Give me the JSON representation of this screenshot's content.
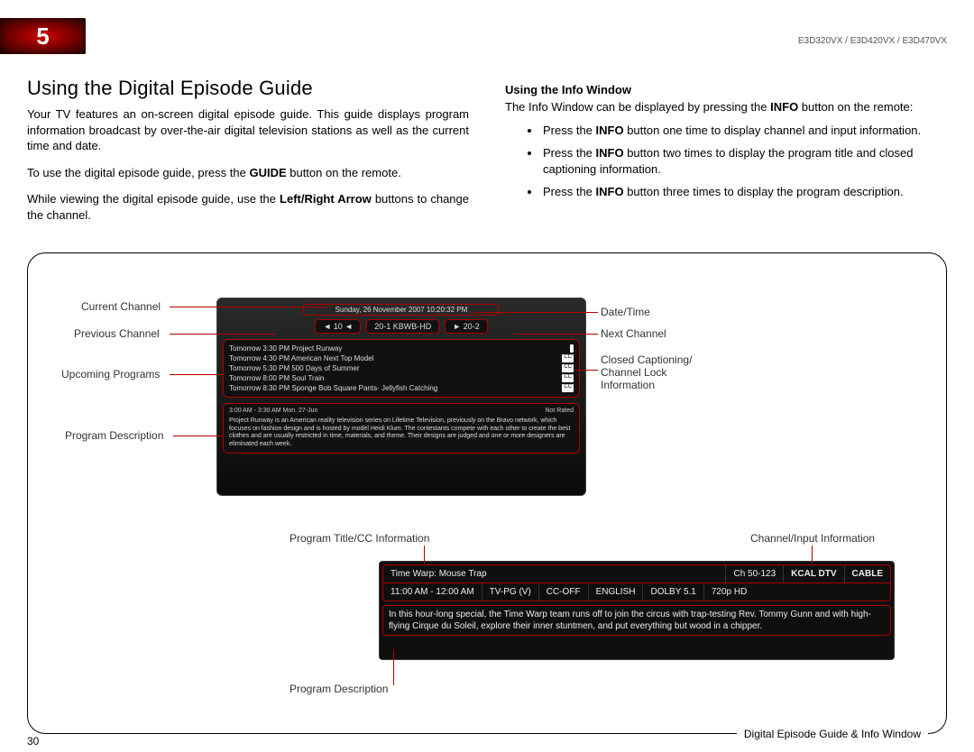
{
  "header": {
    "chapter_number": "5",
    "model_line": "E3D320VX / E3D420VX / E3D470VX"
  },
  "page_number": "30",
  "frame_caption": "Digital Episode Guide & Info Window",
  "left": {
    "heading": "Using the Digital Episode Guide",
    "p1a": "Your TV features an on-screen digital episode guide. This guide displays program information broadcast by over-the-air digital television stations as well as the current time and date.",
    "p2_pre": "To use the digital episode guide, press the ",
    "p2_bold": "GUIDE",
    "p2_post": " button on the remote.",
    "p3_pre": "While viewing the digital episode guide, use the ",
    "p3_bold": "Left/Right Arrow",
    "p3_post": " buttons to change the channel."
  },
  "right": {
    "heading": "Using the Info Window",
    "intro_pre": "The Info Window can be displayed by pressing the ",
    "intro_bold": "INFO",
    "intro_post": " button on the remote:",
    "b1_pre": "Press the ",
    "b1_bold": "INFO",
    "b1_post": " button one time to display channel and input information.",
    "b2_pre": "Press the ",
    "b2_bold": "INFO",
    "b2_post": " button two times to display the program title and closed captioning information.",
    "b3_pre": "Press the ",
    "b3_bold": "INFO",
    "b3_post": " button three times to display the program description."
  },
  "callouts_guide": {
    "current_channel": "Current Channel",
    "previous_channel": "Previous Channel",
    "upcoming_programs": "Upcoming Programs",
    "program_description": "Program Description",
    "date_time": "Date/Time",
    "next_channel": "Next Channel",
    "cc_lock": "Closed Captioning/\nChannel Lock\nInformation"
  },
  "callouts_info": {
    "title_cc": "Program Title/CC Information",
    "channel_input": "Channel/Input Information",
    "program_description": "Program Description"
  },
  "guide_screen": {
    "datebar": "Sunday, 26 November 2007 10:20:32 PM",
    "prev_ch": "◄ 10 ◄",
    "cur_ch": "20-1 KBWB-HD",
    "next_ch": "► 20-2",
    "rows": [
      {
        "l": "Tomorrow  3:30 PM  Project Runway",
        "r": ""
      },
      {
        "l": "Tomorrow  4:30 PM  American Next Top Model",
        "r": "CC"
      },
      {
        "l": "Tomorrow  5:30 PM  500 Days of Summer",
        "r": "CC"
      },
      {
        "l": "Tomorrow  8:00 PM  Soul Train",
        "r": "CC"
      },
      {
        "l": "Tomorrow  8:30 PM  Sponge Bob Square Pants- Jellyfish Catching",
        "r": "CC"
      }
    ],
    "desc_time": "3:00 AM - 3:30 AM Mon. 27-Jun",
    "desc_rating": "Not Rated",
    "desc_body": "Project Runway is an American reality television series on Lifetime Television, previously on the Bravo network, which focuses on fashion design and is hosted by model Heidi Klum. The contestants compete with each other to create the best clothes and are usually restricted in time, materials, and theme. Their designs are judged and one or more designers are eliminated each week."
  },
  "info_screen": {
    "title": "Time Warp: Mouse Trap",
    "ch": "Ch 50-123",
    "station": "KCAL DTV",
    "input": "CABLE",
    "time": "11:00 AM - 12:00 AM",
    "rating": "TV-PG (V)",
    "cc": "CC-OFF",
    "lang": "ENGLISH",
    "audio": "DOLBY 5.1",
    "res": "720p HD",
    "desc": "In this hour-long special, the Time Warp team runs off to join the circus with trap-testing Rev. Tommy Gunn and with high-flying Cirque du Soleil, explore their inner stuntmen, and put everything but wood in a chipper."
  }
}
